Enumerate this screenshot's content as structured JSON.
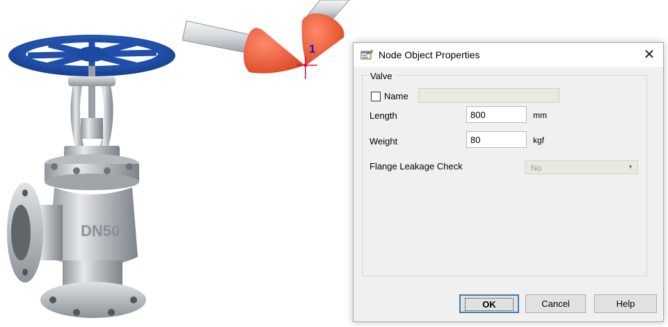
{
  "model_view": {
    "node_label": "1"
  },
  "photo": {
    "embossed_text": "DN50"
  },
  "dialog": {
    "title": "Node Object Properties",
    "close_glyph": "✕",
    "group_label": "Valve",
    "name_label": "Name",
    "name_checked": false,
    "name_value": "",
    "length_label": "Length",
    "length_value": "800",
    "length_unit": "mm",
    "weight_label": "Weight",
    "weight_value": "80",
    "weight_unit": "kgf",
    "flange_label": "Flange Leakage Check",
    "flange_value": "No",
    "buttons": {
      "ok": "OK",
      "cancel": "Cancel",
      "help": "Help"
    }
  },
  "colors": {
    "handwheel": "#1f4fa8",
    "valve_cone": "#f0522d",
    "pipe": "#c8ced2",
    "node_marker": "#d0103a",
    "node_label": "#1a1acc"
  }
}
